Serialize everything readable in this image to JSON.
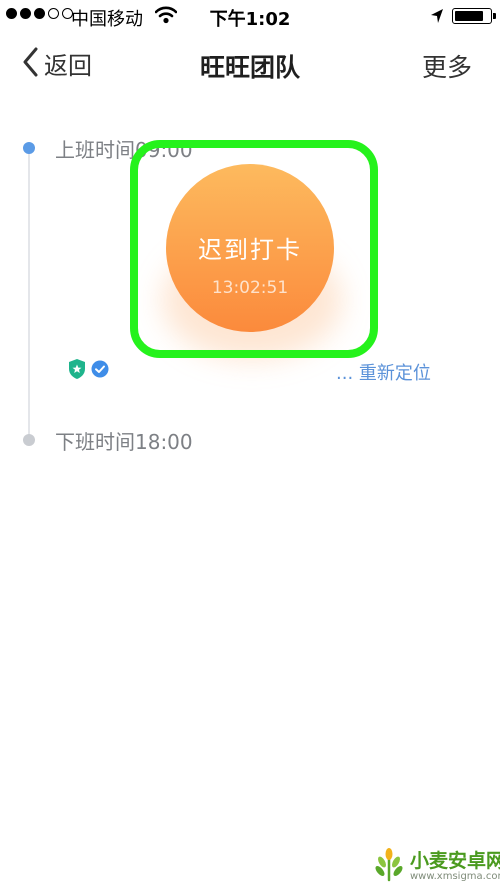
{
  "status_bar": {
    "carrier": "中国移动",
    "time": "下午1:02",
    "signal_strength": 3,
    "signal_max": 5,
    "battery_level": 0.85
  },
  "nav": {
    "back_label": "返回",
    "title": "旺旺团队",
    "more_label": "更多"
  },
  "timeline": {
    "start_label": "上班时间09:00",
    "end_label": "下班时间18:00"
  },
  "clock_in": {
    "label": "迟到打卡",
    "time": "13:02:51"
  },
  "location": {
    "relocate_label": "... 重新定位"
  },
  "watermark": {
    "brand": "小麦安卓网",
    "url": "www.xmsigma.com"
  },
  "colors": {
    "accent_blue": "#5b9be6",
    "clock_gradient_top": "#fdba5e",
    "clock_gradient_bottom": "#fb8a3c",
    "highlight": "#25f21c",
    "badge_green": "#1fb48c"
  }
}
